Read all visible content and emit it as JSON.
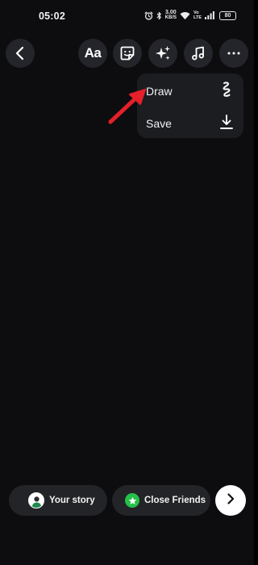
{
  "status_bar": {
    "time": "05:02",
    "net_speed_value": "3.00",
    "net_speed_unit": "KB/S",
    "volte_line1": "Vo",
    "volte_line2": "LTE",
    "battery": "80",
    "icons": [
      "alarm-icon",
      "bluetooth-icon",
      "wifi-icon",
      "signal-icon",
      "battery-icon"
    ]
  },
  "toolbar": {
    "back_icon": "chevron-left-icon",
    "text_tool_label": "Aa",
    "sticker_icon": "sticker-icon",
    "effects_icon": "sparkles-icon",
    "music_icon": "music-note-icon",
    "more_icon": "more-horizontal-icon"
  },
  "menu": {
    "items": [
      {
        "label": "Draw",
        "icon": "scribble-icon"
      },
      {
        "label": "Save",
        "icon": "download-icon"
      }
    ]
  },
  "annotation": {
    "color": "#e5202a",
    "points_to": "Draw"
  },
  "bottom_bar": {
    "your_story_label": "Your story",
    "close_friends_label": "Close Friends",
    "close_friends_color": "#25c04a",
    "next_icon": "chevron-right-icon"
  }
}
